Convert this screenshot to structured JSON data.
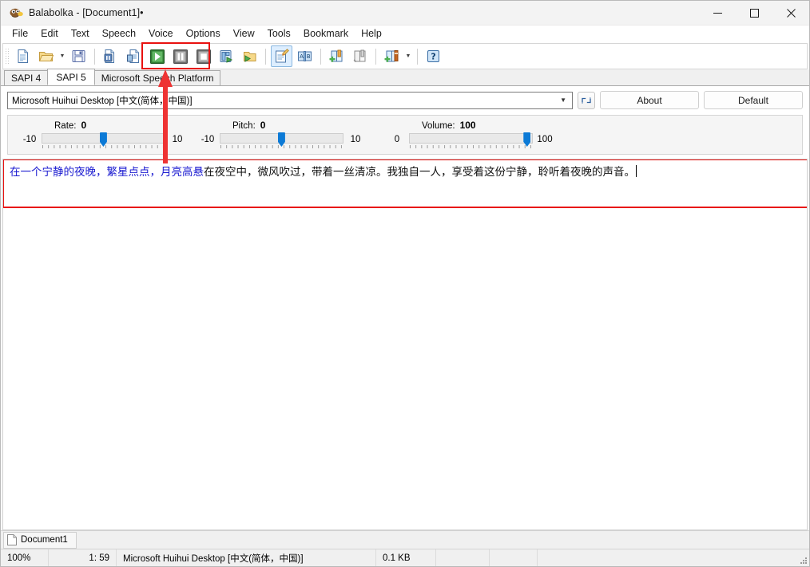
{
  "window": {
    "title": "Balabolka - [Document1]•",
    "app_icon": "balabolka-logo-icon",
    "minimize_label": "—",
    "maximize_label": "□",
    "close_label": "✕"
  },
  "menu": {
    "items": [
      {
        "label": "File"
      },
      {
        "label": "Edit"
      },
      {
        "label": "Text"
      },
      {
        "label": "Speech"
      },
      {
        "label": "Voice"
      },
      {
        "label": "Options"
      },
      {
        "label": "View"
      },
      {
        "label": "Tools"
      },
      {
        "label": "Bookmark"
      },
      {
        "label": "Help"
      }
    ]
  },
  "toolbar": {
    "buttons": [
      {
        "name": "new-document",
        "icon": "new-file-icon"
      },
      {
        "name": "open-file",
        "icon": "open-folder-icon",
        "has_dropdown": true
      },
      {
        "name": "save-file",
        "icon": "floppy-save-icon"
      },
      {
        "name": "save-as-audio",
        "icon": "file-audio-icon"
      },
      {
        "name": "batch-file-conversion",
        "icon": "file-convert-icon"
      },
      {
        "name": "play",
        "icon": "play-triangle-icon",
        "highlighted": true
      },
      {
        "name": "pause",
        "icon": "pause-bars-icon",
        "highlighted": true
      },
      {
        "name": "stop",
        "icon": "stop-square-icon",
        "highlighted": true
      },
      {
        "name": "save-to-audio-file",
        "icon": "audio-save-icon"
      },
      {
        "name": "open-audio-folder",
        "icon": "folder-play-icon"
      },
      {
        "name": "edit-text",
        "icon": "notepad-pencil-icon",
        "active": true
      },
      {
        "name": "spell-check",
        "icon": "ab-book-icon"
      },
      {
        "name": "add-bookmark",
        "icon": "book-add-icon"
      },
      {
        "name": "bookmark-list",
        "icon": "book-open-icon"
      },
      {
        "name": "add-dictionary",
        "icon": "book-dictionary-icon",
        "has_dropdown": true
      },
      {
        "name": "help",
        "icon": "question-help-icon"
      }
    ]
  },
  "tabs": {
    "items": [
      {
        "label": "SAPI 4",
        "selected": false
      },
      {
        "label": "SAPI 5",
        "selected": true
      },
      {
        "label": "Microsoft Speech Platform",
        "selected": false
      }
    ]
  },
  "voice": {
    "selected": "Microsoft Huihui Desktop [中文(简体，中国)]",
    "refresh_icon": "refresh-arrows-icon",
    "dropdown_icon": "chevron-down-icon",
    "about_label": "About",
    "default_label": "Default",
    "sliders": [
      {
        "name": "rate",
        "label": "Rate:",
        "value": "0",
        "min": "-10",
        "max": "10",
        "percent": 50
      },
      {
        "name": "pitch",
        "label": "Pitch:",
        "value": "0",
        "min": "-10",
        "max": "10",
        "percent": 50
      },
      {
        "name": "volume",
        "label": "Volume:",
        "value": "100",
        "min": "0",
        "max": "100",
        "percent": 97
      }
    ]
  },
  "editor": {
    "spoken_text": "在一个宁静的夜晚，繁星点点，月亮高悬",
    "remaining_text": "在夜空中，微风吹过，带着一丝清凉。我独自一人，享受着这份宁静，聆听着夜晚的声音。",
    "highlight_border_color": "#e8110f"
  },
  "document_tabs": {
    "items": [
      {
        "label": "Document1",
        "icon": "document-page-icon"
      }
    ]
  },
  "statusbar": {
    "zoom": "100%",
    "cursor": "1:  59",
    "voice": "Microsoft Huihui Desktop [中文(简体，中国)]",
    "size": "0.1 KB",
    "extra1": "",
    "extra2": "",
    "extra3": ""
  },
  "annotations": {
    "arrow_color": "#ee3333",
    "box_color": "#e8110f"
  }
}
